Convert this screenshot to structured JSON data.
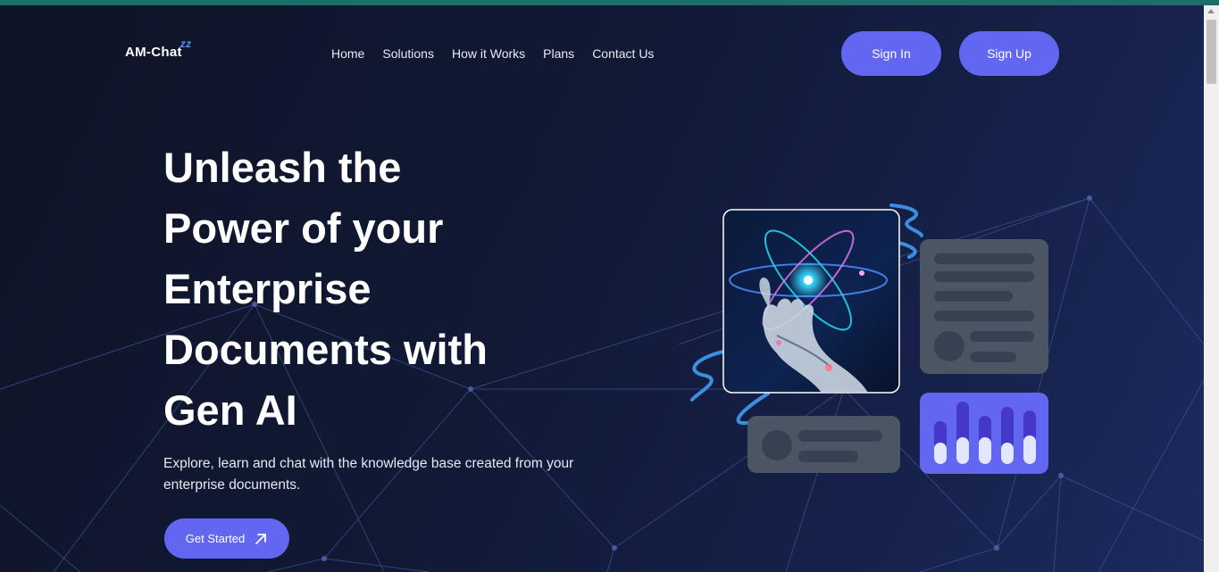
{
  "logo": {
    "text": "AM-Chat",
    "mark": "zz"
  },
  "nav": {
    "items": [
      {
        "label": "Home"
      },
      {
        "label": "Solutions"
      },
      {
        "label": "How it Works"
      },
      {
        "label": "Plans"
      },
      {
        "label": "Contact Us"
      }
    ]
  },
  "auth": {
    "sign_in": "Sign In",
    "sign_up": "Sign Up"
  },
  "hero": {
    "title": "Unleash the Power of your Enterprise Documents with Gen AI",
    "subtitle": "Explore, learn and chat with the knowledge base created from your enterprise documents.",
    "cta_label": "Get Started",
    "cta_icon": "arrow-up-right-icon"
  },
  "illustration": {
    "image_subject": "robotic-hand-atom-image",
    "icons": [
      "document-card-icon",
      "chat-card-icon",
      "bar-chart-card-icon"
    ]
  },
  "colors": {
    "accent": "#6366f1",
    "background_dark": "#0f1630",
    "background_light": "#1c2a5e",
    "card_gray": "#4b5563",
    "swirl_blue": "#3b8fe0",
    "network_line": "#3f4f8f"
  }
}
